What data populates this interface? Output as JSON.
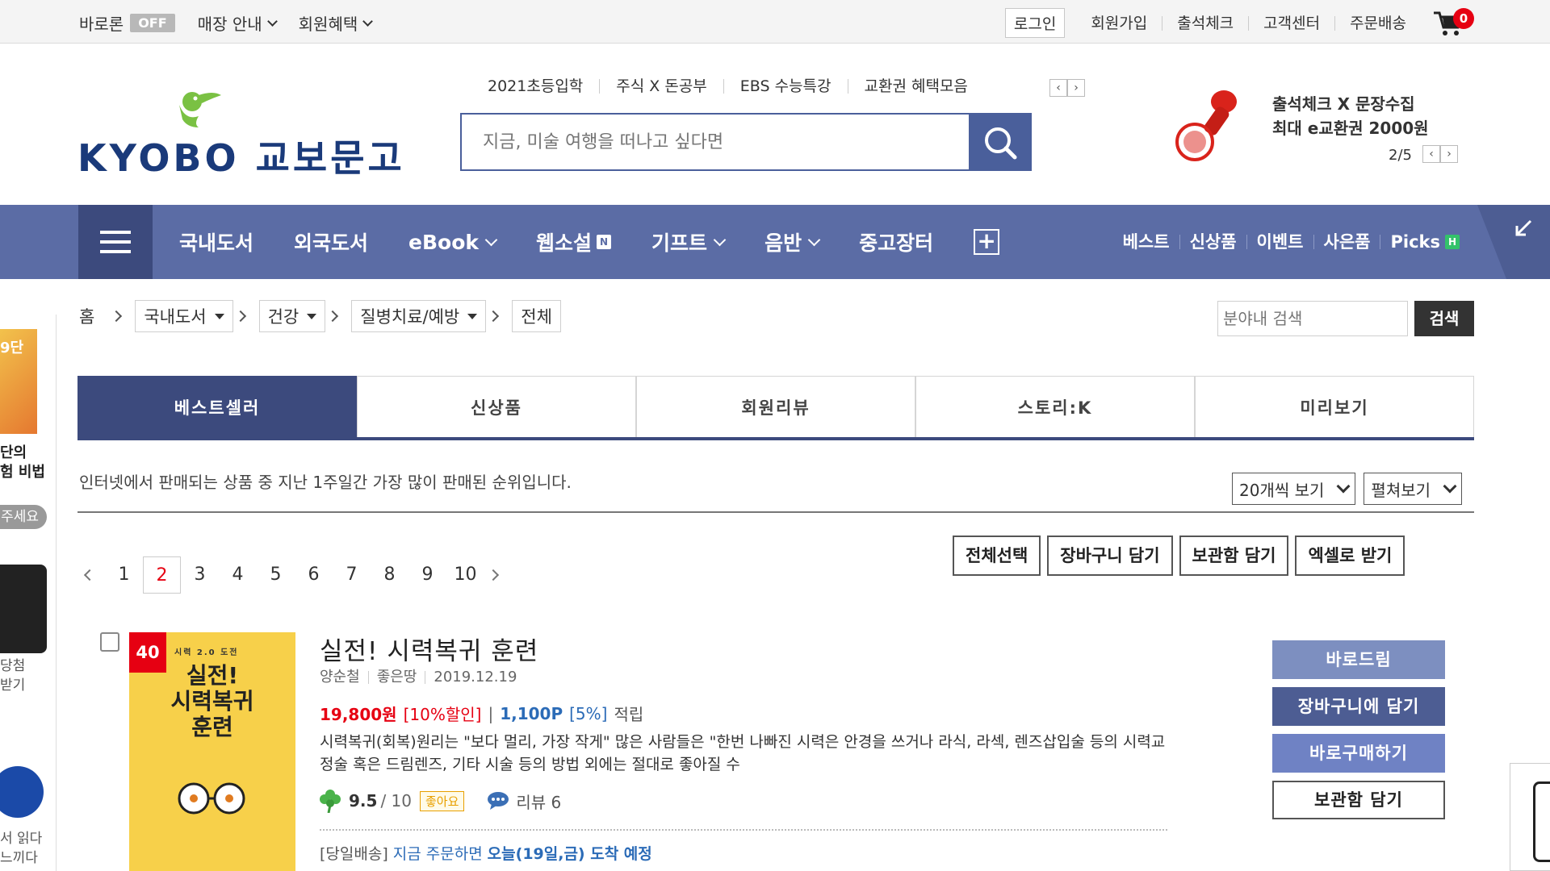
{
  "topbar": {
    "baroreon": "바로론",
    "off": "OFF",
    "store_guide": "매장 안내",
    "member_benefit": "회원혜택",
    "login": "로그인",
    "signup": "회원가입",
    "attendance": "출석체크",
    "customer_center": "고객센터",
    "order_delivery": "주문배송",
    "cart_count": "0"
  },
  "header": {
    "logo_text": "KYOBO 교보문고",
    "keywords": [
      "2021초등입학",
      "주식 X 돈공부",
      "EBS 수능특강",
      "교환권 혜택모음"
    ],
    "search_placeholder": "지금, 미술 여행을 떠나고 싶다면",
    "promo_line1": "출석체크 X 문장수집",
    "promo_line2": "최대 e교환권 2000원",
    "promo_page": "2/5"
  },
  "nav": {
    "items": [
      "국내도서",
      "외국도서",
      "eBook",
      "웹소설",
      "기프트",
      "음반",
      "중고장터"
    ],
    "n_badge": "N",
    "right": [
      "베스트",
      "신상품",
      "이벤트",
      "사은품"
    ],
    "picks": "Picks",
    "h_badge": "H"
  },
  "sidebar": {
    "t1": "9단",
    "t2": "단의",
    "t3": "험 비법",
    "pill": "주세요",
    "t4": "당첨",
    "t5": "받기",
    "t6": "서 읽다",
    "t7": "느끼다"
  },
  "breadcrumb": {
    "home": "홈",
    "level1": "국내도서",
    "level2": "건강",
    "level3": "질병치료/예방",
    "level4": "전체",
    "search_placeholder": "분야내 검색",
    "search_button": "검색"
  },
  "tabs": [
    "베스트셀러",
    "신상품",
    "회원리뷰",
    "스토리:K",
    "미리보기"
  ],
  "tab_description": "인터넷에서 판매되는 상품 중 지난 1주일간 가장 많이 판매된 순위입니다.",
  "view_options": {
    "per_page": "20개씩 보기",
    "view_mode": "펼쳐보기"
  },
  "pagination": {
    "pages": [
      "1",
      "2",
      "3",
      "4",
      "5",
      "6",
      "7",
      "8",
      "9",
      "10"
    ],
    "current": "2"
  },
  "actions": [
    "전체선택",
    "장바구니 담기",
    "보관함 담기",
    "엑셀로 받기"
  ],
  "product": {
    "rank": "40",
    "cover_top": "시력 2.0 도전",
    "cover_title_1": "실전!",
    "cover_title_2": "시력복귀",
    "cover_title_3": "훈련",
    "title": "실전! 시력복귀 훈련",
    "author": "양순철",
    "publisher": "좋은땅",
    "date": "2019.12.19",
    "price": "19,800원",
    "discount": "[10%할인]",
    "separator": "|",
    "points": "1,100P",
    "points_pct": "[5%]",
    "accrue": "적립",
    "description": "시력복귀(회복)원리는 \"보다 멀리, 가장 작게\" 많은 사람들은 \"한번 나빠진 시력은 안경을 쓰거나 라식, 라섹, 렌즈삽입술 등의 시력교정술 혹은 드림렌즈, 기타 시술 등의 방법 외에는 절대로 좋아질 수",
    "rating": "9.5",
    "rating_max": "/ 10",
    "good_badge": "좋아요",
    "review_label": "리뷰 6",
    "delivery_tag": "[당일배송]",
    "delivery_now": "지금 주문하면",
    "delivery_day": "오늘(19일,금) 도착 예정",
    "buttons": [
      "바로드림",
      "장바구니에 담기",
      "바로구매하기",
      "보관함 담기"
    ]
  },
  "colors": {
    "nav_bg": "#5b6ca5",
    "nav_dark": "#3c4a7d",
    "price_red": "#e60012",
    "point_blue": "#2b6bb7"
  }
}
